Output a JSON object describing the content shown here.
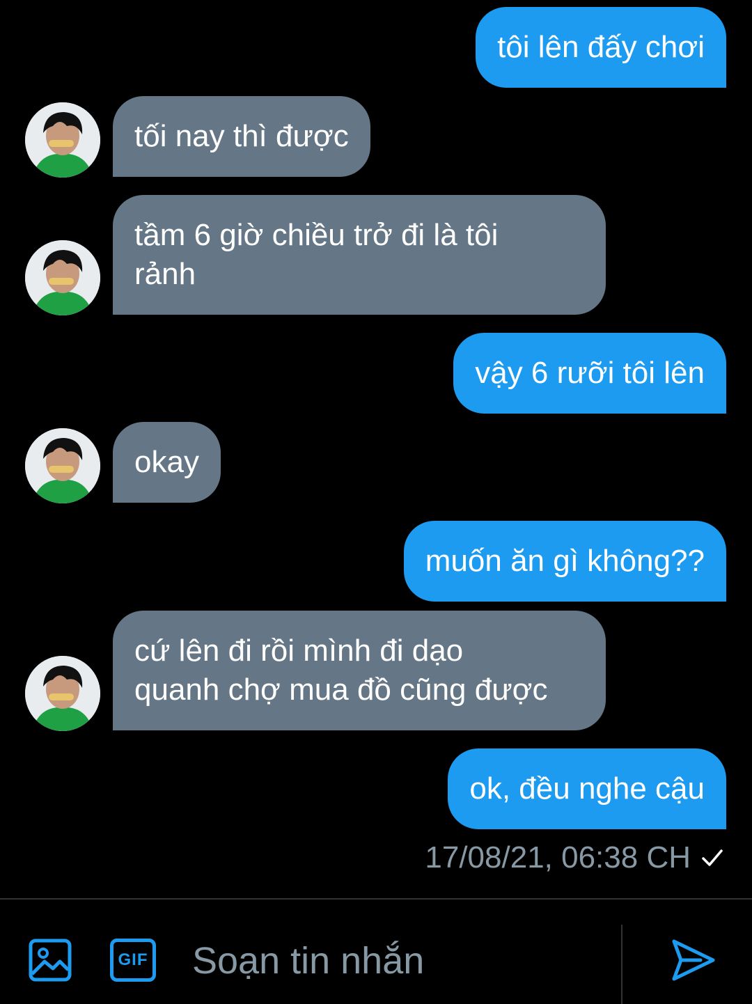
{
  "messages": [
    {
      "id": "m1",
      "side": "sent",
      "text": "tôi lên đấy chơi"
    },
    {
      "id": "m2",
      "side": "received",
      "text": "tối nay thì được"
    },
    {
      "id": "m3",
      "side": "received",
      "text": "tầm 6 giờ chiều trở đi là tôi\nrảnh"
    },
    {
      "id": "m4",
      "side": "sent",
      "text": "vậy 6 rưỡi tôi lên"
    },
    {
      "id": "m5",
      "side": "received",
      "text": "okay"
    },
    {
      "id": "m6",
      "side": "sent",
      "text": "muốn ăn gì không??"
    },
    {
      "id": "m7",
      "side": "received",
      "text": "cứ lên đi rồi mình đi dạo\nquanh chợ mua đồ cũng được"
    },
    {
      "id": "m8",
      "side": "sent",
      "text": "ok, đều nghe cậu"
    }
  ],
  "last_status": {
    "timestamp": "17/08/21, 06:38 CH",
    "icon": "check-icon"
  },
  "composer": {
    "placeholder": "Soạn tin nhắn",
    "value": "",
    "image_icon": "image-icon",
    "gif_label": "GIF",
    "send_icon": "send-icon"
  },
  "colors": {
    "background": "#000000",
    "sent_bubble": "#1d9bf0",
    "received_bubble": "#657786",
    "muted_text": "#8899a6",
    "accent": "#1d9bf0"
  }
}
